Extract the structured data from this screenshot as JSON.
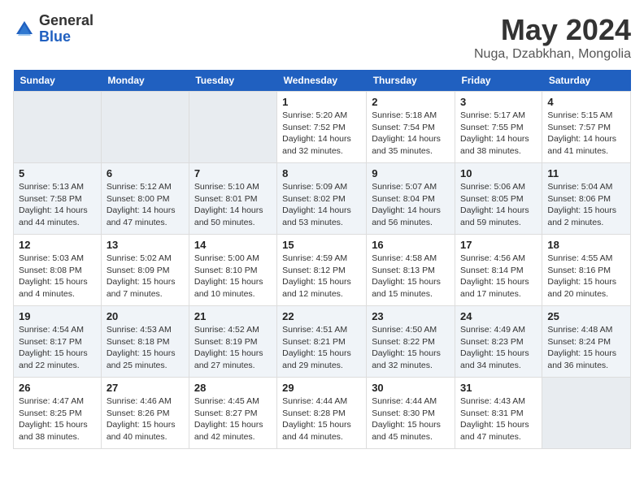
{
  "header": {
    "logo_general": "General",
    "logo_blue": "Blue",
    "month_title": "May 2024",
    "location": "Nuga, Dzabkhan, Mongolia"
  },
  "days_of_week": [
    "Sunday",
    "Monday",
    "Tuesday",
    "Wednesday",
    "Thursday",
    "Friday",
    "Saturday"
  ],
  "weeks": [
    [
      {
        "day": "",
        "sunrise": "",
        "sunset": "",
        "daylight": ""
      },
      {
        "day": "",
        "sunrise": "",
        "sunset": "",
        "daylight": ""
      },
      {
        "day": "",
        "sunrise": "",
        "sunset": "",
        "daylight": ""
      },
      {
        "day": "1",
        "sunrise": "Sunrise: 5:20 AM",
        "sunset": "Sunset: 7:52 PM",
        "daylight": "Daylight: 14 hours and 32 minutes."
      },
      {
        "day": "2",
        "sunrise": "Sunrise: 5:18 AM",
        "sunset": "Sunset: 7:54 PM",
        "daylight": "Daylight: 14 hours and 35 minutes."
      },
      {
        "day": "3",
        "sunrise": "Sunrise: 5:17 AM",
        "sunset": "Sunset: 7:55 PM",
        "daylight": "Daylight: 14 hours and 38 minutes."
      },
      {
        "day": "4",
        "sunrise": "Sunrise: 5:15 AM",
        "sunset": "Sunset: 7:57 PM",
        "daylight": "Daylight: 14 hours and 41 minutes."
      }
    ],
    [
      {
        "day": "5",
        "sunrise": "Sunrise: 5:13 AM",
        "sunset": "Sunset: 7:58 PM",
        "daylight": "Daylight: 14 hours and 44 minutes."
      },
      {
        "day": "6",
        "sunrise": "Sunrise: 5:12 AM",
        "sunset": "Sunset: 8:00 PM",
        "daylight": "Daylight: 14 hours and 47 minutes."
      },
      {
        "day": "7",
        "sunrise": "Sunrise: 5:10 AM",
        "sunset": "Sunset: 8:01 PM",
        "daylight": "Daylight: 14 hours and 50 minutes."
      },
      {
        "day": "8",
        "sunrise": "Sunrise: 5:09 AM",
        "sunset": "Sunset: 8:02 PM",
        "daylight": "Daylight: 14 hours and 53 minutes."
      },
      {
        "day": "9",
        "sunrise": "Sunrise: 5:07 AM",
        "sunset": "Sunset: 8:04 PM",
        "daylight": "Daylight: 14 hours and 56 minutes."
      },
      {
        "day": "10",
        "sunrise": "Sunrise: 5:06 AM",
        "sunset": "Sunset: 8:05 PM",
        "daylight": "Daylight: 14 hours and 59 minutes."
      },
      {
        "day": "11",
        "sunrise": "Sunrise: 5:04 AM",
        "sunset": "Sunset: 8:06 PM",
        "daylight": "Daylight: 15 hours and 2 minutes."
      }
    ],
    [
      {
        "day": "12",
        "sunrise": "Sunrise: 5:03 AM",
        "sunset": "Sunset: 8:08 PM",
        "daylight": "Daylight: 15 hours and 4 minutes."
      },
      {
        "day": "13",
        "sunrise": "Sunrise: 5:02 AM",
        "sunset": "Sunset: 8:09 PM",
        "daylight": "Daylight: 15 hours and 7 minutes."
      },
      {
        "day": "14",
        "sunrise": "Sunrise: 5:00 AM",
        "sunset": "Sunset: 8:10 PM",
        "daylight": "Daylight: 15 hours and 10 minutes."
      },
      {
        "day": "15",
        "sunrise": "Sunrise: 4:59 AM",
        "sunset": "Sunset: 8:12 PM",
        "daylight": "Daylight: 15 hours and 12 minutes."
      },
      {
        "day": "16",
        "sunrise": "Sunrise: 4:58 AM",
        "sunset": "Sunset: 8:13 PM",
        "daylight": "Daylight: 15 hours and 15 minutes."
      },
      {
        "day": "17",
        "sunrise": "Sunrise: 4:56 AM",
        "sunset": "Sunset: 8:14 PM",
        "daylight": "Daylight: 15 hours and 17 minutes."
      },
      {
        "day": "18",
        "sunrise": "Sunrise: 4:55 AM",
        "sunset": "Sunset: 8:16 PM",
        "daylight": "Daylight: 15 hours and 20 minutes."
      }
    ],
    [
      {
        "day": "19",
        "sunrise": "Sunrise: 4:54 AM",
        "sunset": "Sunset: 8:17 PM",
        "daylight": "Daylight: 15 hours and 22 minutes."
      },
      {
        "day": "20",
        "sunrise": "Sunrise: 4:53 AM",
        "sunset": "Sunset: 8:18 PM",
        "daylight": "Daylight: 15 hours and 25 minutes."
      },
      {
        "day": "21",
        "sunrise": "Sunrise: 4:52 AM",
        "sunset": "Sunset: 8:19 PM",
        "daylight": "Daylight: 15 hours and 27 minutes."
      },
      {
        "day": "22",
        "sunrise": "Sunrise: 4:51 AM",
        "sunset": "Sunset: 8:21 PM",
        "daylight": "Daylight: 15 hours and 29 minutes."
      },
      {
        "day": "23",
        "sunrise": "Sunrise: 4:50 AM",
        "sunset": "Sunset: 8:22 PM",
        "daylight": "Daylight: 15 hours and 32 minutes."
      },
      {
        "day": "24",
        "sunrise": "Sunrise: 4:49 AM",
        "sunset": "Sunset: 8:23 PM",
        "daylight": "Daylight: 15 hours and 34 minutes."
      },
      {
        "day": "25",
        "sunrise": "Sunrise: 4:48 AM",
        "sunset": "Sunset: 8:24 PM",
        "daylight": "Daylight: 15 hours and 36 minutes."
      }
    ],
    [
      {
        "day": "26",
        "sunrise": "Sunrise: 4:47 AM",
        "sunset": "Sunset: 8:25 PM",
        "daylight": "Daylight: 15 hours and 38 minutes."
      },
      {
        "day": "27",
        "sunrise": "Sunrise: 4:46 AM",
        "sunset": "Sunset: 8:26 PM",
        "daylight": "Daylight: 15 hours and 40 minutes."
      },
      {
        "day": "28",
        "sunrise": "Sunrise: 4:45 AM",
        "sunset": "Sunset: 8:27 PM",
        "daylight": "Daylight: 15 hours and 42 minutes."
      },
      {
        "day": "29",
        "sunrise": "Sunrise: 4:44 AM",
        "sunset": "Sunset: 8:28 PM",
        "daylight": "Daylight: 15 hours and 44 minutes."
      },
      {
        "day": "30",
        "sunrise": "Sunrise: 4:44 AM",
        "sunset": "Sunset: 8:30 PM",
        "daylight": "Daylight: 15 hours and 45 minutes."
      },
      {
        "day": "31",
        "sunrise": "Sunrise: 4:43 AM",
        "sunset": "Sunset: 8:31 PM",
        "daylight": "Daylight: 15 hours and 47 minutes."
      },
      {
        "day": "",
        "sunrise": "",
        "sunset": "",
        "daylight": ""
      }
    ]
  ]
}
